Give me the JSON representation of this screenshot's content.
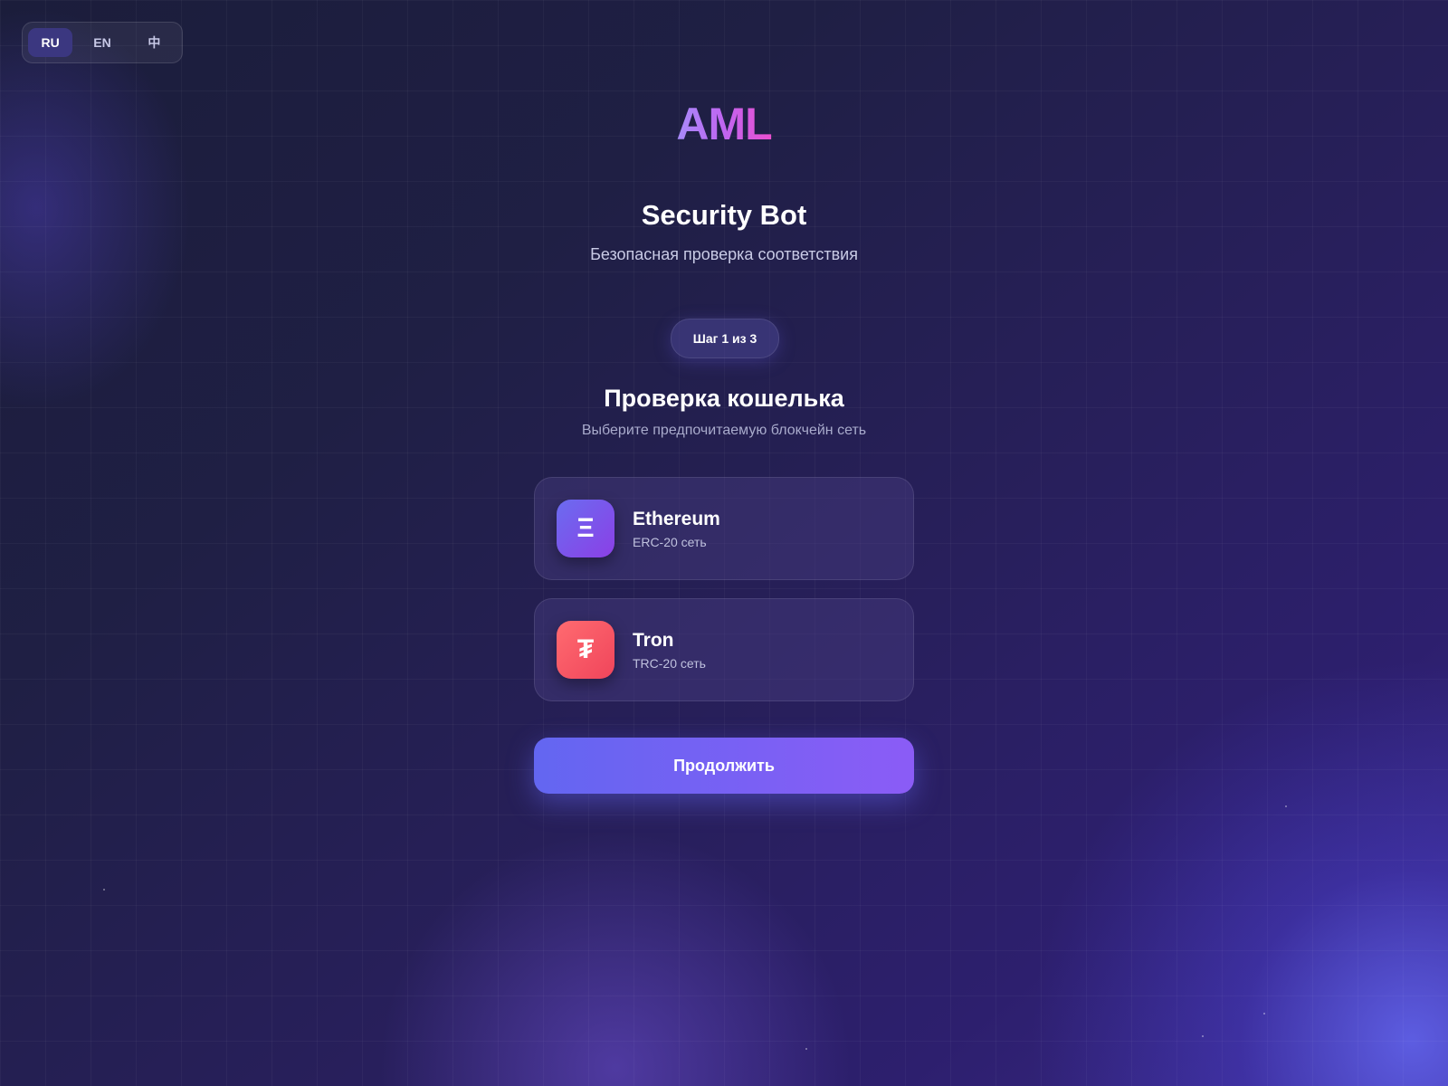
{
  "language_switcher": {
    "options": [
      {
        "label": "RU",
        "active": true
      },
      {
        "label": "EN",
        "active": false
      },
      {
        "label": "中",
        "active": false
      }
    ]
  },
  "brand": {
    "logo_text": "AML",
    "title": "Security Bot",
    "subtitle": "Безопасная проверка соответствия"
  },
  "step": {
    "label": "Шаг 1 из 3"
  },
  "section": {
    "heading": "Проверка кошелька",
    "hint": "Выберите предпочитаемую блокчейн сеть"
  },
  "networks": [
    {
      "name": "Ethereum",
      "subtitle": "ERC-20 сеть",
      "icon": "ethereum-icon",
      "glyph": "Ξ",
      "color_from": "#6b6cf0",
      "color_to": "#8b3fe6"
    },
    {
      "name": "Tron",
      "subtitle": "TRC-20 сеть",
      "icon": "tether-icon",
      "glyph": "₮",
      "color_from": "#ff6b70",
      "color_to": "#f0455b"
    }
  ],
  "actions": {
    "continue_label": "Продолжить"
  },
  "colors": {
    "accent_start": "#6366f1",
    "accent_end": "#8b5cf6",
    "logo_gradient_start": "#a78bfa",
    "logo_gradient_end": "#ec4fcf",
    "active_language_bg": "#3b3780"
  }
}
